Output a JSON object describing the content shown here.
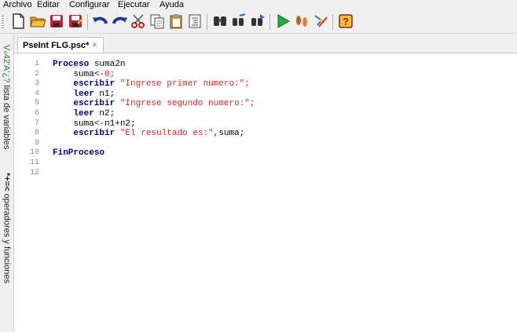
{
  "menu": [
    "Archivo",
    "Editar",
    "Configurar",
    "Ejecutar",
    "Ayuda"
  ],
  "toolbar": {
    "buttons": [
      {
        "name": "new-file-icon"
      },
      {
        "name": "open-folder-icon"
      },
      {
        "name": "save-icon"
      },
      {
        "name": "save-as-icon"
      },
      {
        "name": "undo-icon"
      },
      {
        "name": "redo-icon"
      },
      {
        "name": "cut-icon"
      },
      {
        "name": "copy-icon"
      },
      {
        "name": "paste-icon"
      },
      {
        "name": "indent-icon"
      },
      {
        "name": "search-icon"
      },
      {
        "name": "replace-icon"
      },
      {
        "name": "find-next-icon"
      },
      {
        "name": "run-icon"
      },
      {
        "name": "step-icon"
      },
      {
        "name": "flowchart-icon"
      },
      {
        "name": "help-icon"
      }
    ]
  },
  "sidebar": {
    "variables_label": "lista de variables",
    "variables_symbol": "Vₙ42'A'¿?",
    "operators_label": "operadores y funciones",
    "operators_symbol": "*+=<"
  },
  "tab": {
    "title": "PseInt FLG.psc*",
    "close": "×"
  },
  "editor": {
    "lines": [
      {
        "n": "1",
        "tokens": [
          {
            "t": "Proceso ",
            "c": "kw"
          },
          {
            "t": "suma2n",
            "c": "tx"
          }
        ]
      },
      {
        "n": "2",
        "tokens": [
          {
            "t": "    suma",
            "c": "tx"
          },
          {
            "t": "<-",
            "c": "op"
          },
          {
            "t": "0;",
            "c": "str"
          }
        ]
      },
      {
        "n": "3",
        "tokens": [
          {
            "t": "    escribir ",
            "c": "kw"
          },
          {
            "t": "\"Ingrese primer numero:\";",
            "c": "str"
          }
        ]
      },
      {
        "n": "4",
        "tokens": [
          {
            "t": "    leer ",
            "c": "kw"
          },
          {
            "t": "n1;",
            "c": "tx"
          }
        ]
      },
      {
        "n": "5",
        "tokens": [
          {
            "t": "    escribir ",
            "c": "kw"
          },
          {
            "t": "\"Ingrese segundo numero:\";",
            "c": "str"
          }
        ]
      },
      {
        "n": "6",
        "tokens": [
          {
            "t": "    leer ",
            "c": "kw"
          },
          {
            "t": "n2;",
            "c": "tx"
          }
        ]
      },
      {
        "n": "7",
        "tokens": [
          {
            "t": "    suma",
            "c": "tx"
          },
          {
            "t": "<-",
            "c": "op"
          },
          {
            "t": "n1+n2;",
            "c": "tx"
          }
        ]
      },
      {
        "n": "8",
        "tokens": [
          {
            "t": "    escribir ",
            "c": "kw"
          },
          {
            "t": "\"El resultado es:\"",
            "c": "str"
          },
          {
            "t": ",suma;",
            "c": "tx"
          }
        ]
      },
      {
        "n": "9",
        "tokens": []
      },
      {
        "n": "10",
        "tokens": [
          {
            "t": "FinProceso",
            "c": "kw"
          }
        ]
      },
      {
        "n": "11",
        "tokens": []
      },
      {
        "n": "12",
        "tokens": []
      }
    ]
  }
}
